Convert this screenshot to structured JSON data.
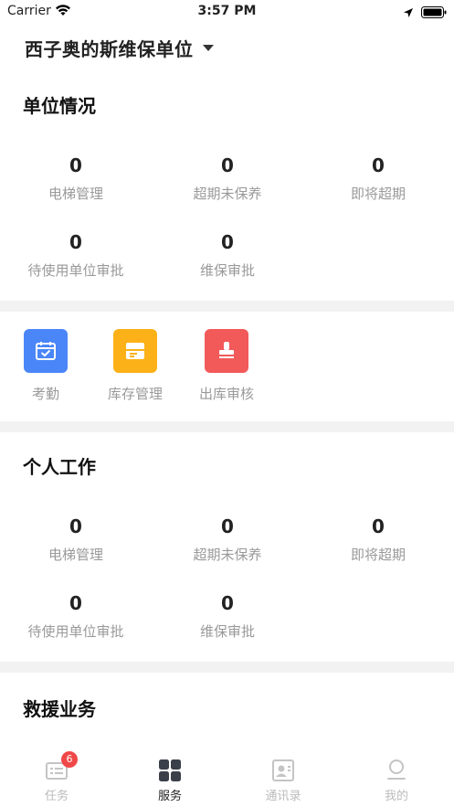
{
  "status_bar": {
    "carrier": "Carrier",
    "time": "3:57 PM"
  },
  "header": {
    "unit_name": "西子奥的斯维保单位"
  },
  "unit_section": {
    "title": "单位情况",
    "stats": [
      {
        "value": "0",
        "label": "电梯管理"
      },
      {
        "value": "0",
        "label": "超期未保养"
      },
      {
        "value": "0",
        "label": "即将超期"
      },
      {
        "value": "0",
        "label": "待使用单位审批"
      },
      {
        "value": "0",
        "label": "维保审批"
      }
    ]
  },
  "services": [
    {
      "label": "考勤",
      "icon": "calendar-check-icon",
      "color": "#4a86f7"
    },
    {
      "label": "库存管理",
      "icon": "box-icon",
      "color": "#fbb117"
    },
    {
      "label": "出库审核",
      "icon": "stamp-icon",
      "color": "#f25a5a"
    }
  ],
  "personal_section": {
    "title": "个人工作",
    "stats": [
      {
        "value": "0",
        "label": "电梯管理"
      },
      {
        "value": "0",
        "label": "超期未保养"
      },
      {
        "value": "0",
        "label": "即将超期"
      },
      {
        "value": "0",
        "label": "待使用单位审批"
      },
      {
        "value": "0",
        "label": "维保审批"
      }
    ]
  },
  "rescue_section": {
    "title": "救援业务"
  },
  "tabbar": {
    "tabs": [
      {
        "label": "任务",
        "icon": "task-list-icon",
        "badge": "6",
        "active": false
      },
      {
        "label": "服务",
        "icon": "grid-icon",
        "active": true
      },
      {
        "label": "通讯录",
        "icon": "contacts-icon",
        "active": false
      },
      {
        "label": "我的",
        "icon": "profile-icon",
        "active": false
      }
    ]
  }
}
